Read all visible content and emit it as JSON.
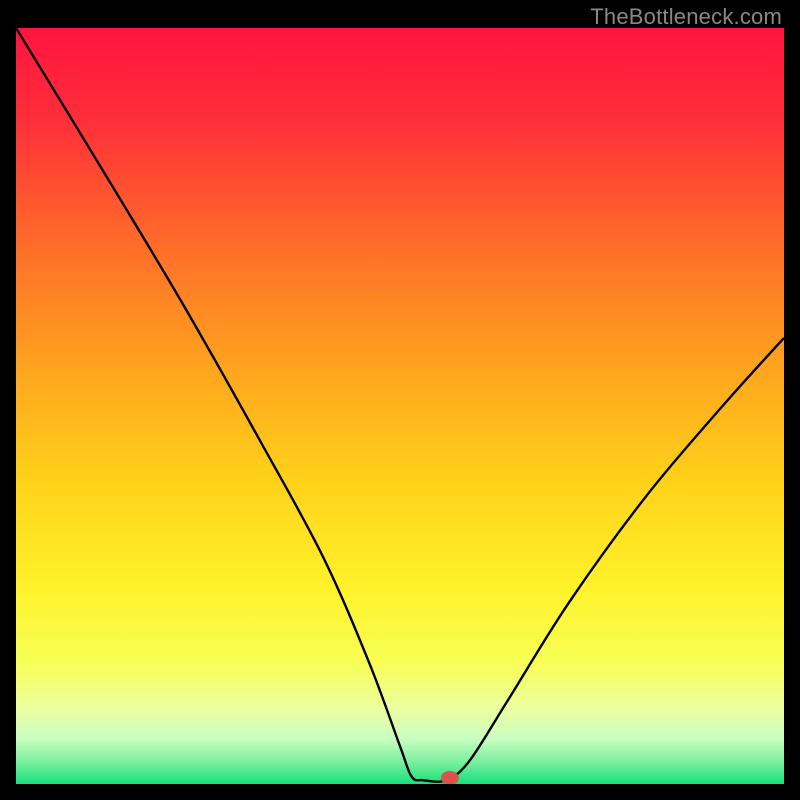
{
  "watermark": "TheBottleneck.com",
  "chart_data": {
    "type": "line",
    "title": "",
    "xlabel": "",
    "ylabel": "",
    "xlim": [
      0,
      100
    ],
    "ylim": [
      0,
      100
    ],
    "curve": [
      {
        "x": 0,
        "y": 100
      },
      {
        "x": 12,
        "y": 80
      },
      {
        "x": 22,
        "y": 63
      },
      {
        "x": 32,
        "y": 45
      },
      {
        "x": 40,
        "y": 30
      },
      {
        "x": 46,
        "y": 16
      },
      {
        "x": 50,
        "y": 5
      },
      {
        "x": 51.5,
        "y": 1
      },
      {
        "x": 53,
        "y": 0.5
      },
      {
        "x": 56,
        "y": 0.5
      },
      {
        "x": 59,
        "y": 3
      },
      {
        "x": 64,
        "y": 11
      },
      {
        "x": 72,
        "y": 24
      },
      {
        "x": 82,
        "y": 38
      },
      {
        "x": 92,
        "y": 50
      },
      {
        "x": 100,
        "y": 59
      }
    ],
    "marker": {
      "x": 56.5,
      "y": 0.8
    },
    "gradient_stops": [
      {
        "offset": 0.0,
        "color": "#ff143f"
      },
      {
        "offset": 0.12,
        "color": "#ff2e3a"
      },
      {
        "offset": 0.28,
        "color": "#ff6a2a"
      },
      {
        "offset": 0.44,
        "color": "#ffa11f"
      },
      {
        "offset": 0.6,
        "color": "#ffd21a"
      },
      {
        "offset": 0.74,
        "color": "#fff22a"
      },
      {
        "offset": 0.84,
        "color": "#f7ff55"
      },
      {
        "offset": 0.9,
        "color": "#ecffa0"
      },
      {
        "offset": 0.94,
        "color": "#c8ffc0"
      },
      {
        "offset": 0.97,
        "color": "#7df0a0"
      },
      {
        "offset": 1.0,
        "color": "#16e07a"
      }
    ]
  }
}
